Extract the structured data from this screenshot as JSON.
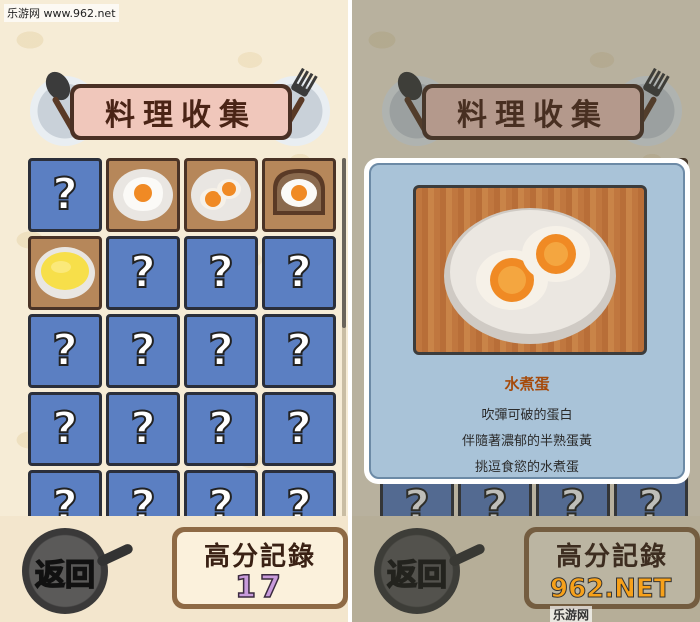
{
  "watermark_top": "乐游网 www.962.net",
  "left": {
    "title": "料理收集",
    "grid": [
      {
        "type": "locked",
        "label": "?"
      },
      {
        "type": "food",
        "icon": "fried-egg-icon"
      },
      {
        "type": "food",
        "icon": "boiled-egg-icon"
      },
      {
        "type": "food",
        "icon": "egg-toast-icon"
      },
      {
        "type": "food",
        "icon": "scrambled-egg-icon"
      },
      {
        "type": "locked",
        "label": "?"
      },
      {
        "type": "locked",
        "label": "?"
      },
      {
        "type": "locked",
        "label": "?"
      },
      {
        "type": "locked",
        "label": "?"
      },
      {
        "type": "locked",
        "label": "?"
      },
      {
        "type": "locked",
        "label": "?"
      },
      {
        "type": "locked",
        "label": "?"
      },
      {
        "type": "locked",
        "label": "?"
      },
      {
        "type": "locked",
        "label": "?"
      },
      {
        "type": "locked",
        "label": "?"
      },
      {
        "type": "locked",
        "label": "?"
      },
      {
        "type": "locked",
        "label": "?"
      },
      {
        "type": "locked",
        "label": "?"
      },
      {
        "type": "locked",
        "label": "?"
      },
      {
        "type": "locked",
        "label": "?"
      }
    ],
    "back_label": "返回",
    "score_title": "高分記錄",
    "score_value": "17"
  },
  "right": {
    "title": "料理收集",
    "detail": {
      "name": "水煮蛋",
      "desc1": "吹彈可破的蛋白",
      "desc2": "伴隨著濃郁的半熟蛋黃",
      "desc3": "挑逗食慾的水煮蛋"
    },
    "back_label": "返回",
    "score_title": "高分記錄"
  },
  "watermark_bottom": {
    "main": "962.NET",
    "sub": "乐游网"
  },
  "colors": {
    "locked_cell": "#5b7fc2",
    "title_bg": "#f0c7bb",
    "title_border": "#4a3024",
    "detail_bg": "#a9c3d8",
    "score_value": "#c89bdc"
  }
}
